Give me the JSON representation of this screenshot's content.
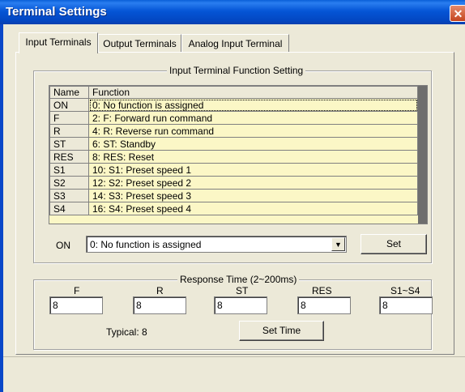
{
  "window": {
    "title": "Terminal Settings",
    "close_glyph": "✕"
  },
  "tabs": [
    {
      "label": "Input Terminals",
      "active": true
    },
    {
      "label": "Output Terminals",
      "active": false
    },
    {
      "label": "Analog Input Terminal",
      "active": false
    }
  ],
  "function_group": {
    "title": "Input Terminal Function Setting"
  },
  "grid": {
    "columns": [
      "Name",
      "Function"
    ],
    "rows": [
      [
        "ON",
        "0: No function is assigned"
      ],
      [
        "F",
        "2: F: Forward run command"
      ],
      [
        "R",
        "4: R: Reverse run command"
      ],
      [
        "ST",
        "6: ST: Standby"
      ],
      [
        "RES",
        "8: RES: Reset"
      ],
      [
        "S1",
        "10: S1: Preset speed 1"
      ],
      [
        "S2",
        "12: S2: Preset speed 2"
      ],
      [
        "S3",
        "14: S3: Preset speed 3"
      ],
      [
        "S4",
        "16: S4: Preset speed 4"
      ]
    ]
  },
  "editor": {
    "terminal_label": "ON",
    "selected_function": "0: No function is assigned",
    "set_label": "Set"
  },
  "response_group": {
    "title": "Response Time (2~200ms)",
    "fields": [
      {
        "label": "F",
        "value": "8"
      },
      {
        "label": "R",
        "value": "8"
      },
      {
        "label": "ST",
        "value": "8"
      },
      {
        "label": "RES",
        "value": "8"
      },
      {
        "label": "S1~S4",
        "value": "8"
      }
    ],
    "typical_text": "Typical: 8",
    "set_time_label": "Set Time"
  },
  "colors": {
    "titlebar": "#0555d6",
    "grid_background": "#fbf7c6",
    "dialog_face": "#ece9d8"
  }
}
